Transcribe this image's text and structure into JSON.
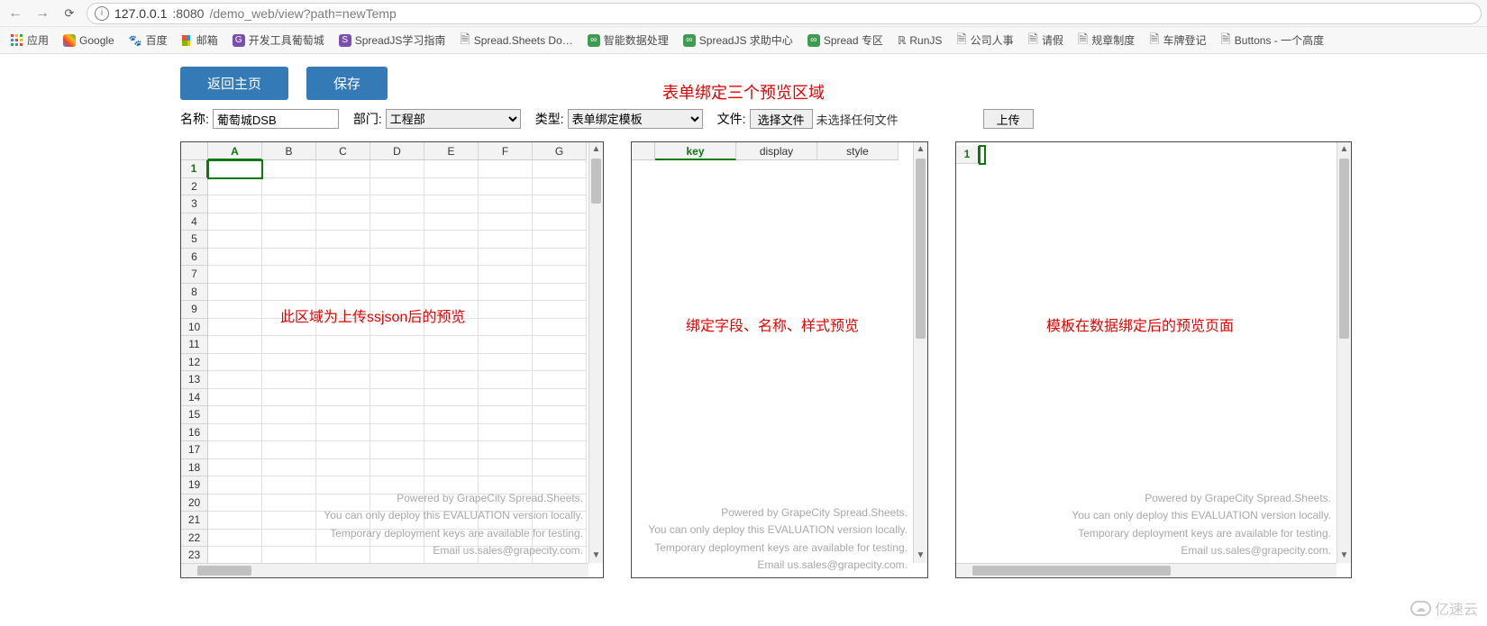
{
  "browser": {
    "url_host": "127.0.0.1",
    "url_port": ":8080",
    "url_path": "/demo_web/view?path=newTemp"
  },
  "bookmarks": {
    "apps": "应用",
    "items": [
      "Google",
      "百度",
      "邮箱",
      "开发工具葡萄城",
      "SpreadJS学习指南",
      "Spread.Sheets Do…",
      "智能数据处理",
      "SpreadJS 求助中心",
      "Spread 专区",
      "RunJS",
      "公司人事",
      "请假",
      "规章制度",
      "车牌登记",
      "Buttons - 一个高度"
    ]
  },
  "toolbar": {
    "back": "返回主页",
    "save": "保存"
  },
  "annotation_title": "表单绑定三个预览区域",
  "form": {
    "name_label": "名称:",
    "name_value": "葡萄城DSB",
    "dept_label": "部门:",
    "dept_value": "工程部",
    "type_label": "类型:",
    "type_value": "表单绑定模板",
    "file_label": "文件:",
    "file_button": "选择文件",
    "file_hint": "未选择任何文件",
    "upload": "上传"
  },
  "sheets": {
    "sheet1": {
      "cols": [
        "A",
        "B",
        "C",
        "D",
        "E",
        "F",
        "G"
      ],
      "row_count": 23,
      "overlay": "此区域为上传ssjson后的预览"
    },
    "sheet2": {
      "cols": [
        "key",
        "display",
        "style"
      ],
      "overlay": "绑定字段、名称、样式预览"
    },
    "sheet3": {
      "row_label": "1",
      "overlay": "模板在数据绑定后的预览页面"
    }
  },
  "watermark": {
    "l1": "Powered by GrapeCity Spread.Sheets.",
    "l2": "You can only deploy this EVALUATION version locally.",
    "l3": "Temporary deployment keys are available for testing.",
    "l4": "Email us.sales@grapecity.com."
  },
  "footer": "亿速云"
}
